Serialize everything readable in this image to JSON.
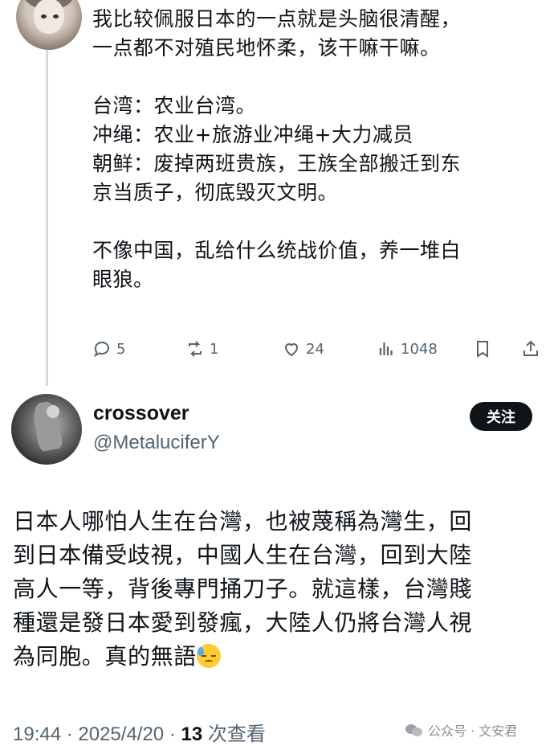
{
  "post1": {
    "lines": [
      "我比较佩服日本的一点就是头脑很清醒，",
      "一点都不对殖民地怀柔，该干嘛干嘛。",
      "",
      "台湾：农业台湾。",
      "冲绳：农业+旅游业冲绳+大力减员",
      "朝鲜：废掉两班贵族，王族全部搬迁到东",
      "京当质子，彻底毁灭文明。",
      "",
      "不像中国，乱给什么统战价值，养一堆白",
      "眼狼。"
    ],
    "actions": {
      "replies": "5",
      "reposts": "1",
      "likes": "24",
      "views": "1048"
    }
  },
  "post2": {
    "display_name": "crossover",
    "handle": "@MetaluciferY",
    "follow_label": "关注",
    "lines": [
      "日本人哪怕人生在台灣，也被蔑稱為灣生，回",
      "到日本備受歧視，中國人生在台灣，回到大陸",
      "高人一等，背後專門捅刀子。就這樣，台灣賤",
      "種還是發日本愛到發瘋，大陸人仍將台灣人視",
      "為同胞。真的無語"
    ],
    "emoji": "downcast-face-with-sweat",
    "timestamp": "19:44 · 2025/4/20 · ",
    "views_count": "13",
    "views_label": " 次查看"
  },
  "watermark": "公众号 · 文安君",
  "colors": {
    "text": "#0f1419",
    "secondary": "#536471",
    "thread_line": "#cfd9de",
    "follow_bg": "#0f1419"
  }
}
